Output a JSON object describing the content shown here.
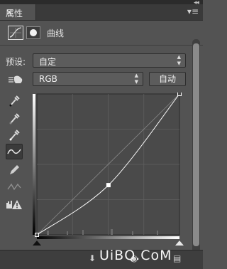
{
  "panel": {
    "tab_label": "属性",
    "close_glyph": "×",
    "menu_glyph": "▾≡",
    "collapse_glyph": "◂◂"
  },
  "properties": {
    "title": "曲线",
    "icons": [
      "curves-adjustment-icon",
      "layer-mask-icon"
    ]
  },
  "preset": {
    "label": "预设:",
    "value": "自定"
  },
  "channel": {
    "value": "RGB",
    "auto_button": "自动"
  },
  "tools": [
    "hand-adjust-icon",
    "black-point-eyedropper-icon",
    "gray-point-eyedropper-icon",
    "white-point-eyedropper-icon",
    "edit-points-curve-icon",
    "pencil-draw-icon",
    "smooth-icon",
    "clipping-warning-icon"
  ],
  "curve": {
    "points": [
      [
        0,
        0
      ],
      [
        128,
        90
      ],
      [
        255,
        255
      ]
    ],
    "input_range": [
      0,
      255
    ],
    "output_range": [
      0,
      255
    ]
  },
  "watermark": {
    "text": "UiBQ.CoM"
  }
}
